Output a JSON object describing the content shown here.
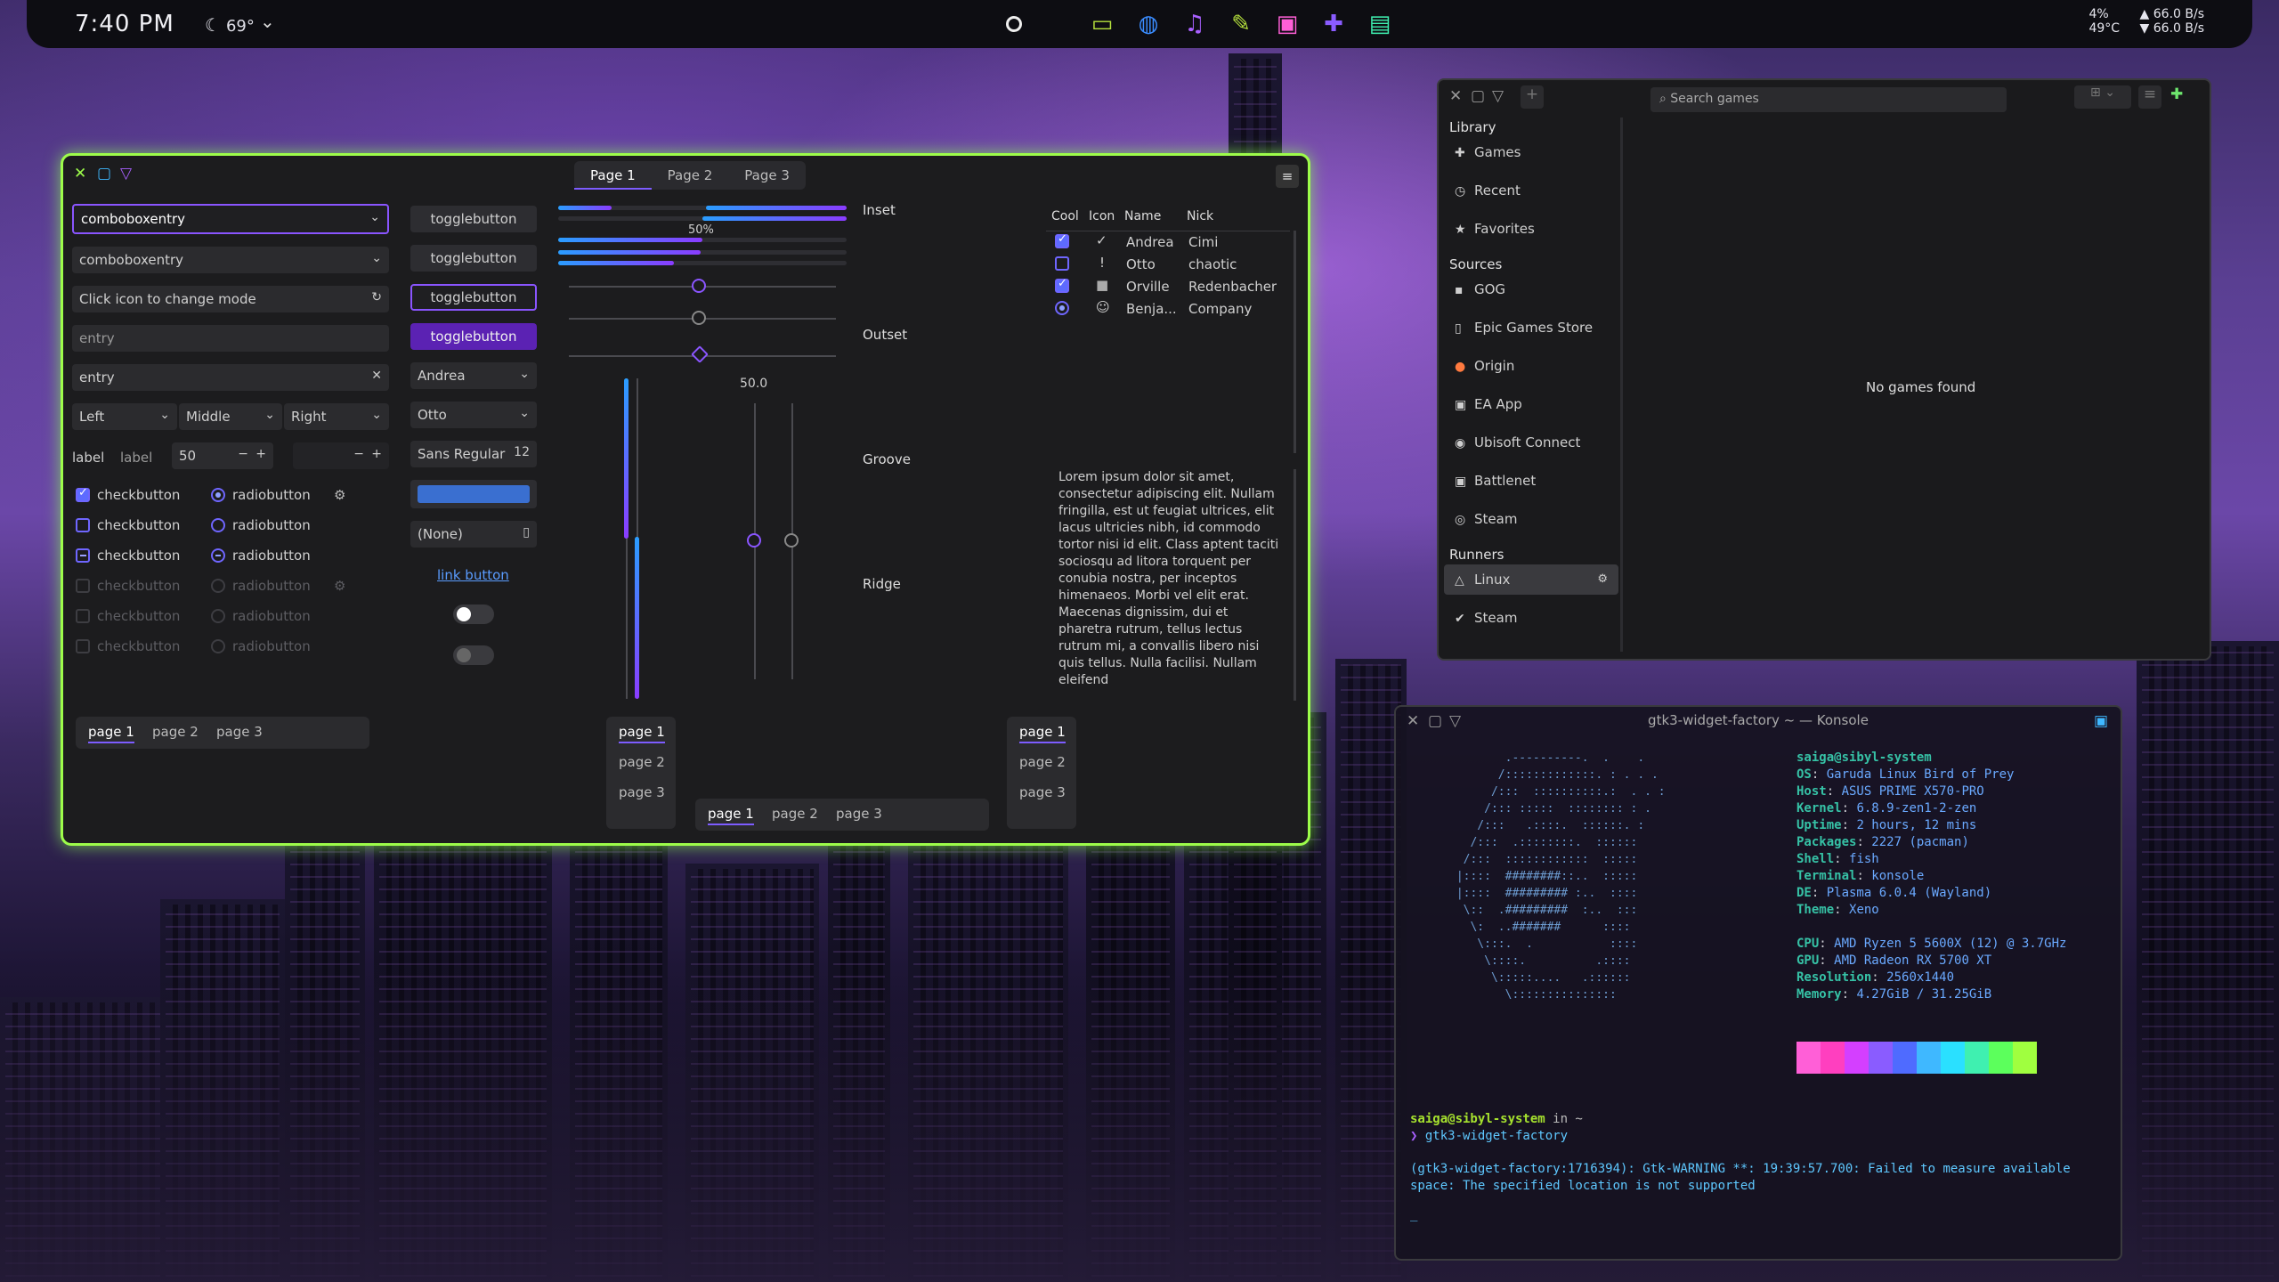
{
  "topbar": {
    "time": "7:40 PM",
    "weather": "69°",
    "cpu": "4%",
    "temp": "49°C",
    "net_up": "66.0 B/s",
    "net_down": "66.0 B/s",
    "dock_icons": [
      "folder-icon",
      "browser-icon",
      "music-icon",
      "notes-icon",
      "video-icon",
      "games-icon",
      "terminal-icon"
    ]
  },
  "factory": {
    "tabs": [
      "Page 1",
      "Page 2",
      "Page 3"
    ],
    "combo1": "comboboxentry",
    "combo2": "comboboxentry",
    "entry_icon": "Click icon to change mode",
    "entry1": "entry",
    "entry2": "entry",
    "align": [
      "Left",
      "Middle",
      "Right"
    ],
    "label1": "label",
    "label2": "label",
    "spin_value": "50",
    "checkbuttons": [
      "checkbutton",
      "checkbutton",
      "checkbutton",
      "checkbutton",
      "checkbutton",
      "checkbutton"
    ],
    "radiobuttons": [
      "radiobutton",
      "radiobutton",
      "radiobutton",
      "radiobutton",
      "radiobutton",
      "radiobutton"
    ],
    "togglebuttons": [
      "togglebutton",
      "togglebutton",
      "togglebutton",
      "togglebutton"
    ],
    "combo_andrea": "Andrea",
    "combo_otto": "Otto",
    "font_button": "Sans Regular",
    "font_size": "12",
    "file_button": "(None)",
    "link_button": "link button",
    "progress_label": "50%",
    "scale_value": "50.0",
    "progress": 0.5,
    "frames": [
      "Inset",
      "Outset",
      "Groove",
      "Ridge"
    ],
    "tree_headers": [
      "Cool",
      "Icon",
      "Name",
      "Nick"
    ],
    "tree_rows": [
      {
        "name": "Andrea",
        "nick": "Cimi",
        "icon": "✓"
      },
      {
        "name": "Otto",
        "nick": "chaotic",
        "icon": "!"
      },
      {
        "name": "Orville",
        "nick": "Redenbacher",
        "icon": "■"
      },
      {
        "name": "Benja...",
        "nick": "Company",
        "icon": "☺"
      }
    ],
    "lorem": "Lorem ipsum dolor sit amet, consectetur adipiscing elit. Nullam fringilla, est ut feugiat ultrices, elit lacus ultricies nibh, id commodo tortor nisi id elit. Class aptent taciti sociosqu ad litora torquent per conubia nostra, per inceptos himenaeos. Morbi vel elit erat. Maecenas dignissim, dui et pharetra rutrum, tellus lectus rutrum mi, a convallis libero nisi quis tellus. Nulla facilisi. Nullam eleifend",
    "pages": [
      "page 1",
      "page 2",
      "page 3"
    ]
  },
  "launcher": {
    "search_placeholder": "Search games",
    "sections": {
      "library": "Library",
      "sources": "Sources",
      "runners": "Runners"
    },
    "library_items": [
      "Games",
      "Recent",
      "Favorites"
    ],
    "source_items": [
      "GOG",
      "Epic Games Store",
      "Origin",
      "EA App",
      "Ubisoft Connect",
      "Battlenet",
      "Steam"
    ],
    "runner_items": [
      "Linux",
      "Steam"
    ],
    "empty": "No games found"
  },
  "konsole": {
    "title": "gtk3-widget-factory ~ — Konsole",
    "user_host": "saiga@sibyl-system",
    "info": [
      {
        "k": "OS",
        "v": "Garuda Linux Bird of Prey"
      },
      {
        "k": "Host",
        "v": "ASUS PRIME X570-PRO"
      },
      {
        "k": "Kernel",
        "v": "6.8.9-zen1-2-zen"
      },
      {
        "k": "Uptime",
        "v": "2 hours, 12 mins"
      },
      {
        "k": "Packages",
        "v": "2227 (pacman)"
      },
      {
        "k": "Shell",
        "v": "fish"
      },
      {
        "k": "Terminal",
        "v": "konsole"
      },
      {
        "k": "DE",
        "v": "Plasma 6.0.4 (Wayland)"
      },
      {
        "k": "Theme",
        "v": "Xeno"
      },
      {
        "k": "CPU",
        "v": "AMD Ryzen 5 5600X (12) @ 3.7GHz"
      },
      {
        "k": "GPU",
        "v": "AMD Radeon RX 5700 XT"
      },
      {
        "k": "Resolution",
        "v": "2560x1440"
      },
      {
        "k": "Memory",
        "v": "4.27GiB / 31.25GiB"
      }
    ],
    "prompt_user": "saiga@sibyl-system",
    "prompt_in": " in ~",
    "command": "gtk3-widget-factory",
    "warning": "(gtk3-widget-factory:1716394): Gtk-WARNING **: 19:39:57.700: Failed to measure available space: The specified location is not supported",
    "palette": [
      "#ff5fd7",
      "#ff3fbf",
      "#d43fff",
      "#8a5cff",
      "#4f6bff",
      "#3fb8ff",
      "#2ae0ff",
      "#3ff0b0",
      "#5cff5c",
      "#a0ff3f"
    ]
  }
}
